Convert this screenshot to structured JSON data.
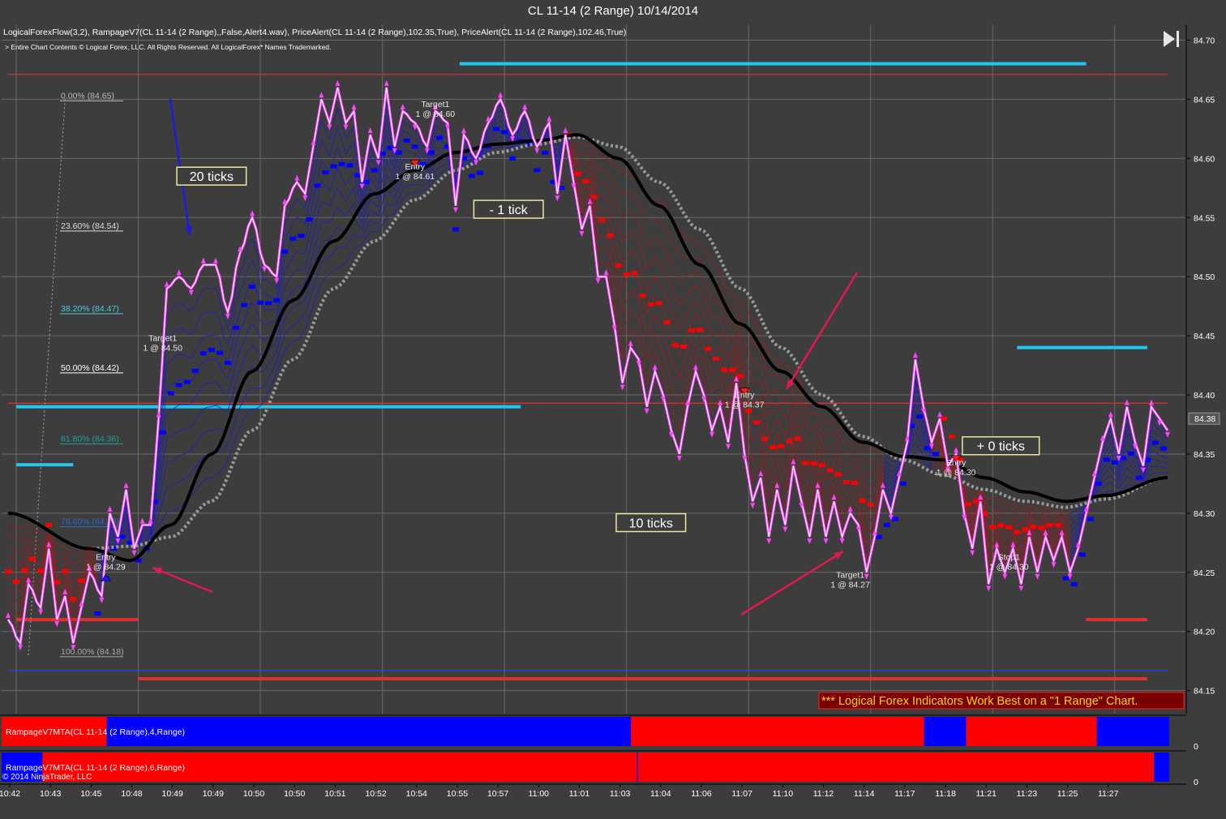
{
  "window": {
    "title": "CL 11-14 (2 Range)  10/14/2014"
  },
  "header": {
    "indicators": "LogicalForexFlow(3,2), RampageV7(CL 11-14 (2 Range),,False,Alert4.wav), PriceAlert(CL 11-14 (2 Range),102.35,True), PriceAlert(CL 11-14 (2 Range),102.46,True)",
    "copyright": "> Entire Chart Contents © Logical Forex, LLC. All Rights Reserved. All LogicalForex* Names Trademarked."
  },
  "footer": {
    "notice": "*** Logical Forex Indicators Work Best on a \"1 Range\" Chart.",
    "ninja": "© 2014 NinjaTrader, LLC"
  },
  "colors": {
    "background": "#3d3d3d",
    "grid": "#6a6a6a",
    "price": "#ff44ff",
    "bull": "#0000ff",
    "bear": "#ff0000",
    "midline": "#000000",
    "slowline": "#9a9a9a",
    "level_blue": "#1ec8f0",
    "level_red": "#e03030",
    "price_label_bg": "#555555"
  },
  "panels": [
    {
      "label": "RampageV7MTA(CL 11-14 (2 Range),4,Range)",
      "zero": "0",
      "segments": [
        {
          "c": "red",
          "a": 0,
          "b": 0.09
        },
        {
          "c": "blue",
          "a": 0.09,
          "b": 0.539
        },
        {
          "c": "red",
          "a": 0.539,
          "b": 0.79
        },
        {
          "c": "blue",
          "a": 0.79,
          "b": 0.826
        },
        {
          "c": "red",
          "a": 0.826,
          "b": 0.938
        },
        {
          "c": "blue",
          "a": 0.938,
          "b": 1
        }
      ]
    },
    {
      "label": "RampageV7MTA(CL 11-14 (2 Range),6,Range)",
      "zero": "0",
      "segments": [
        {
          "c": "blue",
          "a": 0,
          "b": 0.035
        },
        {
          "c": "red",
          "a": 0.035,
          "b": 0.544
        },
        {
          "c": "blue",
          "a": 0.544,
          "b": 0.545
        },
        {
          "c": "red",
          "a": 0.545,
          "b": 0.987
        },
        {
          "c": "blue",
          "a": 0.987,
          "b": 1
        }
      ]
    }
  ],
  "chart_data": {
    "type": "line",
    "title": "CL 11-14 (2 Range)  10/14/2014",
    "ylim": [
      84.14,
      84.71
    ],
    "xlim": [
      0,
      285
    ],
    "y_ticks": [
      "84.70",
      "84.65",
      "84.60",
      "84.55",
      "84.50",
      "84.45",
      "84.40",
      "84.35",
      "84.30",
      "84.25",
      "84.20",
      "84.15"
    ],
    "x_ticks": [
      {
        "i": 0,
        "label": "10:42"
      },
      {
        "i": 10,
        "label": "10:43"
      },
      {
        "i": 20,
        "label": "10:45"
      },
      {
        "i": 30,
        "label": "10:48"
      },
      {
        "i": 40,
        "label": "10:49"
      },
      {
        "i": 50,
        "label": "10:49"
      },
      {
        "i": 60,
        "label": "10:50"
      },
      {
        "i": 70,
        "label": "10:50"
      },
      {
        "i": 80,
        "label": "10:51"
      },
      {
        "i": 90,
        "label": "10:52"
      },
      {
        "i": 100,
        "label": "10:54"
      },
      {
        "i": 110,
        "label": "10:55"
      },
      {
        "i": 120,
        "label": "10:57"
      },
      {
        "i": 130,
        "label": "11:00"
      },
      {
        "i": 140,
        "label": "11:01"
      },
      {
        "i": 150,
        "label": "11:03"
      },
      {
        "i": 160,
        "label": "11:04"
      },
      {
        "i": 170,
        "label": "11:06"
      },
      {
        "i": 180,
        "label": "11:07"
      },
      {
        "i": 190,
        "label": "11:10"
      },
      {
        "i": 200,
        "label": "11:12"
      },
      {
        "i": 210,
        "label": "11:14"
      },
      {
        "i": 220,
        "label": "11:17"
      },
      {
        "i": 230,
        "label": "11:18"
      },
      {
        "i": 240,
        "label": "11:21"
      },
      {
        "i": 250,
        "label": "11:23"
      },
      {
        "i": 260,
        "label": "11:25"
      },
      {
        "i": 270,
        "label": "11:27"
      }
    ],
    "price_anchors": [
      [
        0,
        84.21
      ],
      [
        3,
        84.19
      ],
      [
        5,
        84.24
      ],
      [
        8,
        84.22
      ],
      [
        10,
        84.27
      ],
      [
        12,
        84.21
      ],
      [
        14,
        84.23
      ],
      [
        16,
        84.19
      ],
      [
        18,
        84.22
      ],
      [
        20,
        84.25
      ],
      [
        23,
        84.23
      ],
      [
        25,
        84.3
      ],
      [
        27,
        84.28
      ],
      [
        29,
        84.32
      ],
      [
        31,
        84.27
      ],
      [
        33,
        84.29
      ],
      [
        35,
        84.29
      ],
      [
        37,
        84.38
      ],
      [
        39,
        84.49
      ],
      [
        42,
        84.5
      ],
      [
        45,
        84.49
      ],
      [
        48,
        84.51
      ],
      [
        51,
        84.51
      ],
      [
        54,
        84.47
      ],
      [
        57,
        84.52
      ],
      [
        60,
        84.55
      ],
      [
        63,
        84.51
      ],
      [
        66,
        84.5
      ],
      [
        68,
        84.56
      ],
      [
        71,
        84.58
      ],
      [
        73,
        84.57
      ],
      [
        75,
        84.61
      ],
      [
        77,
        84.65
      ],
      [
        79,
        84.63
      ],
      [
        81,
        84.66
      ],
      [
        83,
        84.63
      ],
      [
        85,
        84.64
      ],
      [
        87,
        84.58
      ],
      [
        89,
        84.62
      ],
      [
        91,
        84.6
      ],
      [
        93,
        84.66
      ],
      [
        95,
        84.61
      ],
      [
        97,
        84.64
      ],
      [
        100,
        84.63
      ],
      [
        103,
        84.61
      ],
      [
        105,
        84.64
      ],
      [
        108,
        84.63
      ],
      [
        110,
        84.56
      ],
      [
        112,
        84.62
      ],
      [
        115,
        84.6
      ],
      [
        118,
        84.63
      ],
      [
        121,
        84.65
      ],
      [
        124,
        84.62
      ],
      [
        127,
        84.64
      ],
      [
        130,
        84.61
      ],
      [
        133,
        84.63
      ],
      [
        135,
        84.57
      ],
      [
        137,
        84.62
      ],
      [
        139,
        84.58
      ],
      [
        141,
        84.54
      ],
      [
        143,
        84.56
      ],
      [
        145,
        84.5
      ],
      [
        147,
        84.5
      ],
      [
        149,
        84.46
      ],
      [
        151,
        84.41
      ],
      [
        153,
        84.44
      ],
      [
        155,
        84.43
      ],
      [
        157,
        84.39
      ],
      [
        159,
        84.42
      ],
      [
        161,
        84.4
      ],
      [
        163,
        84.37
      ],
      [
        165,
        84.35
      ],
      [
        167,
        84.39
      ],
      [
        169,
        84.42
      ],
      [
        171,
        84.4
      ],
      [
        173,
        84.37
      ],
      [
        175,
        84.39
      ],
      [
        177,
        84.36
      ],
      [
        179,
        84.41
      ],
      [
        181,
        84.35
      ],
      [
        183,
        84.31
      ],
      [
        185,
        84.33
      ],
      [
        187,
        84.28
      ],
      [
        189,
        84.32
      ],
      [
        191,
        84.29
      ],
      [
        193,
        84.34
      ],
      [
        195,
        84.31
      ],
      [
        197,
        84.28
      ],
      [
        199,
        84.32
      ],
      [
        201,
        84.28
      ],
      [
        203,
        84.31
      ],
      [
        205,
        84.28
      ],
      [
        207,
        84.3
      ],
      [
        209,
        84.29
      ],
      [
        211,
        84.25
      ],
      [
        213,
        84.28
      ],
      [
        215,
        84.32
      ],
      [
        217,
        84.3
      ],
      [
        219,
        84.33
      ],
      [
        221,
        84.36
      ],
      [
        223,
        84.43
      ],
      [
        225,
        84.39
      ],
      [
        227,
        84.36
      ],
      [
        229,
        84.38
      ],
      [
        231,
        84.34
      ],
      [
        233,
        84.35
      ],
      [
        235,
        84.3
      ],
      [
        237,
        84.27
      ],
      [
        239,
        84.31
      ],
      [
        241,
        84.24
      ],
      [
        243,
        84.27
      ],
      [
        245,
        84.25
      ],
      [
        247,
        84.27
      ],
      [
        249,
        84.24
      ],
      [
        251,
        84.28
      ],
      [
        253,
        84.25
      ],
      [
        255,
        84.28
      ],
      [
        257,
        84.26
      ],
      [
        259,
        84.28
      ],
      [
        261,
        84.25
      ],
      [
        263,
        84.27
      ],
      [
        265,
        84.3
      ],
      [
        267,
        84.33
      ],
      [
        269,
        84.36
      ],
      [
        271,
        84.38
      ],
      [
        273,
        84.35
      ],
      [
        275,
        84.39
      ],
      [
        277,
        84.36
      ],
      [
        279,
        84.34
      ],
      [
        281,
        84.39
      ],
      [
        283,
        84.38
      ],
      [
        285,
        84.37
      ]
    ],
    "ma_anchors": [
      [
        0,
        84.3
      ],
      [
        20,
        84.27
      ],
      [
        30,
        84.26
      ],
      [
        40,
        84.29
      ],
      [
        50,
        84.35
      ],
      [
        60,
        84.42
      ],
      [
        70,
        84.48
      ],
      [
        80,
        84.53
      ],
      [
        90,
        84.57
      ],
      [
        100,
        84.59
      ],
      [
        110,
        84.605
      ],
      [
        120,
        84.612
      ],
      [
        130,
        84.615
      ],
      [
        140,
        84.62
      ],
      [
        150,
        84.6
      ],
      [
        160,
        84.56
      ],
      [
        170,
        84.51
      ],
      [
        180,
        84.46
      ],
      [
        190,
        84.42
      ],
      [
        200,
        84.39
      ],
      [
        210,
        84.36
      ],
      [
        220,
        84.348
      ],
      [
        230,
        84.345
      ],
      [
        240,
        84.33
      ],
      [
        250,
        84.318
      ],
      [
        260,
        84.31
      ],
      [
        270,
        84.315
      ],
      [
        285,
        84.33
      ]
    ],
    "slow_anchors": [
      [
        0,
        84.3
      ],
      [
        20,
        84.27
      ],
      [
        30,
        84.272
      ],
      [
        40,
        84.28
      ],
      [
        50,
        84.31
      ],
      [
        60,
        84.37
      ],
      [
        70,
        84.43
      ],
      [
        80,
        84.49
      ],
      [
        90,
        84.53
      ],
      [
        100,
        84.565
      ],
      [
        110,
        84.59
      ],
      [
        120,
        84.605
      ],
      [
        130,
        84.612
      ],
      [
        140,
        84.618
      ],
      [
        150,
        84.61
      ],
      [
        160,
        84.58
      ],
      [
        170,
        84.54
      ],
      [
        180,
        84.49
      ],
      [
        190,
        84.44
      ],
      [
        200,
        84.4
      ],
      [
        210,
        84.365
      ],
      [
        220,
        84.345
      ],
      [
        230,
        84.332
      ],
      [
        240,
        84.32
      ],
      [
        250,
        84.31
      ],
      [
        260,
        84.305
      ],
      [
        270,
        84.312
      ],
      [
        285,
        84.33
      ]
    ],
    "last_price": "84.38",
    "fib_levels": [
      {
        "label": "0.00% (84.65)",
        "value": 84.65
      },
      {
        "label": "23.60% (84.54)",
        "value": 84.54
      },
      {
        "label": "38.20% (84.47)",
        "value": 84.47
      },
      {
        "label": "50.00% (84.42)",
        "value": 84.42
      },
      {
        "label": "61.80% (84.36)",
        "value": 84.36
      },
      {
        "label": "78.60% (84.29)",
        "value": 84.29
      },
      {
        "label": "100.00% (84.18)",
        "value": 84.18
      }
    ],
    "horizontal_levels": [
      {
        "value": 84.671,
        "color": "red",
        "from": 0,
        "to": 285
      },
      {
        "value": 84.393,
        "color": "red",
        "from": 0,
        "to": 285
      },
      {
        "value": 84.167,
        "color": "blue",
        "from": 0,
        "to": 285
      },
      {
        "value": 84.68,
        "color": "cyan",
        "from": 111,
        "to": 265
      },
      {
        "value": 84.39,
        "color": "cyan",
        "from": 2,
        "to": 126
      },
      {
        "value": 84.44,
        "color": "cyan",
        "from": 248,
        "to": 280
      },
      {
        "value": 84.341,
        "color": "cyan",
        "from": 2,
        "to": 16
      },
      {
        "value": 84.16,
        "color": "red",
        "from": 32,
        "to": 280
      },
      {
        "value": 84.21,
        "color": "red",
        "from": 2,
        "to": 32
      },
      {
        "value": 84.21,
        "color": "red",
        "from": 265,
        "to": 280
      }
    ],
    "trades": [
      {
        "kind": "Entry",
        "text": "1 @ 84.29",
        "i": 24,
        "value": 84.255,
        "side": "buy"
      },
      {
        "kind": "Target1",
        "text": "1 @ 84.50",
        "i": 38,
        "value": 84.44,
        "side": "label"
      },
      {
        "kind": "Entry",
        "text": "1 @ 84.61",
        "i": 100,
        "value": 84.585,
        "side": "sell"
      },
      {
        "kind": "Target1",
        "text": "1 @ 84.60",
        "i": 105,
        "value": 84.638,
        "side": "label"
      },
      {
        "kind": "Entry",
        "text": "1 @ 84.37",
        "i": 181,
        "value": 84.392,
        "side": "sell"
      },
      {
        "kind": "Target1",
        "text": "1 @ 84.27",
        "i": 207,
        "value": 84.24,
        "side": "label"
      },
      {
        "kind": "Entry",
        "text": "1 @ 84.30",
        "i": 233,
        "value": 84.335,
        "side": "sell"
      },
      {
        "kind": "Stop1",
        "text": "1 @ 84.30",
        "i": 246,
        "value": 84.255,
        "side": "label"
      }
    ],
    "annotations": [
      {
        "text": "20 ticks",
        "i": 50,
        "value": 84.585
      },
      {
        "text": "- 1 tick",
        "i": 123,
        "value": 84.557
      },
      {
        "text": "10 ticks",
        "i": 158,
        "value": 84.292
      },
      {
        "text": "+ 0 ticks",
        "i": 244,
        "value": 84.357
      }
    ]
  }
}
